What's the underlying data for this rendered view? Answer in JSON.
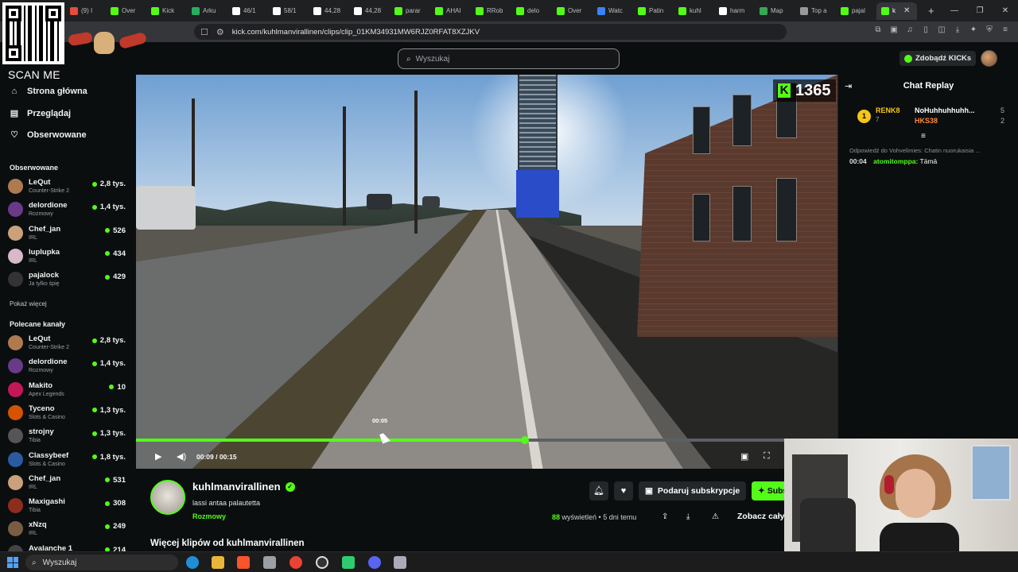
{
  "browser": {
    "tabs": [
      {
        "label": "(9) I",
        "color": "#e74c3c"
      },
      {
        "label": "Over",
        "color": "#53fc18"
      },
      {
        "label": "Kick",
        "color": "#53fc18"
      },
      {
        "label": "Arku",
        "color": "#27ae60"
      },
      {
        "label": "46/1",
        "color": "#ffffff"
      },
      {
        "label": "58/1",
        "color": "#ffffff"
      },
      {
        "label": "44,28",
        "color": "#ffffff"
      },
      {
        "label": "44,28",
        "color": "#ffffff"
      },
      {
        "label": "parar",
        "color": "#53fc18"
      },
      {
        "label": "AHAI",
        "color": "#53fc18"
      },
      {
        "label": "RRob",
        "color": "#53fc18"
      },
      {
        "label": "delo",
        "color": "#53fc18"
      },
      {
        "label": "Over",
        "color": "#53fc18"
      },
      {
        "label": "Watc",
        "color": "#3b82f6"
      },
      {
        "label": "Patin",
        "color": "#53fc18"
      },
      {
        "label": "kuhl",
        "color": "#53fc18"
      },
      {
        "label": "harm",
        "color": "#ffffff"
      },
      {
        "label": "Map",
        "color": "#34a853"
      },
      {
        "label": "Top a",
        "color": "#999999"
      },
      {
        "label": "pajal",
        "color": "#53fc18"
      },
      {
        "label": "k",
        "color": "#53fc18",
        "active": true
      }
    ],
    "url": "kick.com/kuhlmanvirallinen/clips/clip_01KM34931MW6RJZ0RFAT8XZJKV"
  },
  "overlay": {
    "scan_me": "SCAN ME"
  },
  "header": {
    "search_placeholder": "Wyszukaj",
    "kicks_label": "Zdobądź KICKs"
  },
  "sidebar": {
    "nav": [
      {
        "label": "Strona główna",
        "icon": "home-icon"
      },
      {
        "label": "Przeglądaj",
        "icon": "browse-icon"
      },
      {
        "label": "Obserwowane",
        "icon": "heart-icon"
      }
    ],
    "following_title": "Obserwowane",
    "following": [
      {
        "name": "LeQut",
        "category": "Counter-Strike 2",
        "viewers": "2,8 tys.",
        "color": "#b07a4f"
      },
      {
        "name": "delordione",
        "category": "Rozmowy",
        "viewers": "1,4 tys.",
        "color": "#6a3a8a"
      },
      {
        "name": "Chef_jan",
        "category": "IRL",
        "viewers": "526",
        "color": "#c9a27b"
      },
      {
        "name": "luplupka",
        "category": "IRL",
        "viewers": "434",
        "color": "#d9b8c8"
      },
      {
        "name": "pajalock",
        "category": "Ja tylko śpię",
        "viewers": "429",
        "color": "#333333"
      }
    ],
    "show_more": "Pokaż więcej",
    "recommended_title": "Polecane kanały",
    "recommended": [
      {
        "name": "LeQut",
        "category": "Counter-Strike 2",
        "viewers": "2,8 tys.",
        "color": "#b07a4f"
      },
      {
        "name": "delordione",
        "category": "Rozmowy",
        "viewers": "1,4 tys.",
        "color": "#6a3a8a"
      },
      {
        "name": "Makito",
        "category": "Apex Legends",
        "viewers": "10",
        "color": "#c2185b"
      },
      {
        "name": "Tyceno",
        "category": "Slots & Casino",
        "viewers": "1,3 tys.",
        "color": "#d35400"
      },
      {
        "name": "strojny",
        "category": "Tibia",
        "viewers": "1,3 tys.",
        "color": "#555555"
      },
      {
        "name": "Classybeef",
        "category": "Slots & Casino",
        "viewers": "1,8 tys.",
        "color": "#2c5aa0"
      },
      {
        "name": "Chef_jan",
        "category": "IRL",
        "viewers": "531",
        "color": "#c9a27b"
      },
      {
        "name": "Maxigashi",
        "category": "Tibia",
        "viewers": "308",
        "color": "#8e2d1e"
      },
      {
        "name": "xNzq",
        "category": "IRL",
        "viewers": "249",
        "color": "#7a5c45"
      },
      {
        "name": "Avalanche 1",
        "category": "",
        "viewers": "214",
        "color": "#444444"
      }
    ]
  },
  "video": {
    "kick_count": "1365",
    "kick_badge": "K",
    "hover_time": "00:05",
    "current_time": "00:09",
    "duration": "00:15",
    "progress_fraction": 0.6,
    "hover_fraction": 0.379
  },
  "clip": {
    "streamer": "kuhlmanvirallinen",
    "title": "lassi antaa palautetta",
    "category": "Rozmowy",
    "subscribe_label": "Podaruj subskrypcje",
    "follow_label": "Subskrybuj",
    "views_count": "88",
    "views_label": "wyświetleń",
    "age": "5 dni temu",
    "see_all": "Zobacz cały",
    "more_clips": "Więcej klipów od kuhlmanvirallinen"
  },
  "chat": {
    "title": "Chat Replay",
    "gifter_rank": "1",
    "top_gifter": "RENK8",
    "top_gifter_count": "7",
    "gifter2": "NoHuhhuhhuhh...",
    "gifter2_count": "5",
    "gifter3": "HKS38",
    "gifter3_count": "2",
    "reply_to": "Odpowiedź do Vohvelimies: Chatin nuorukaisia ...",
    "message_time": "00:04",
    "message_user": "atomitomppa:",
    "message_text": "Tämä"
  },
  "taskbar": {
    "search_placeholder": "Wyszukaj"
  },
  "colors": {
    "accent": "#53fc18",
    "background": "#0b0e0f"
  }
}
